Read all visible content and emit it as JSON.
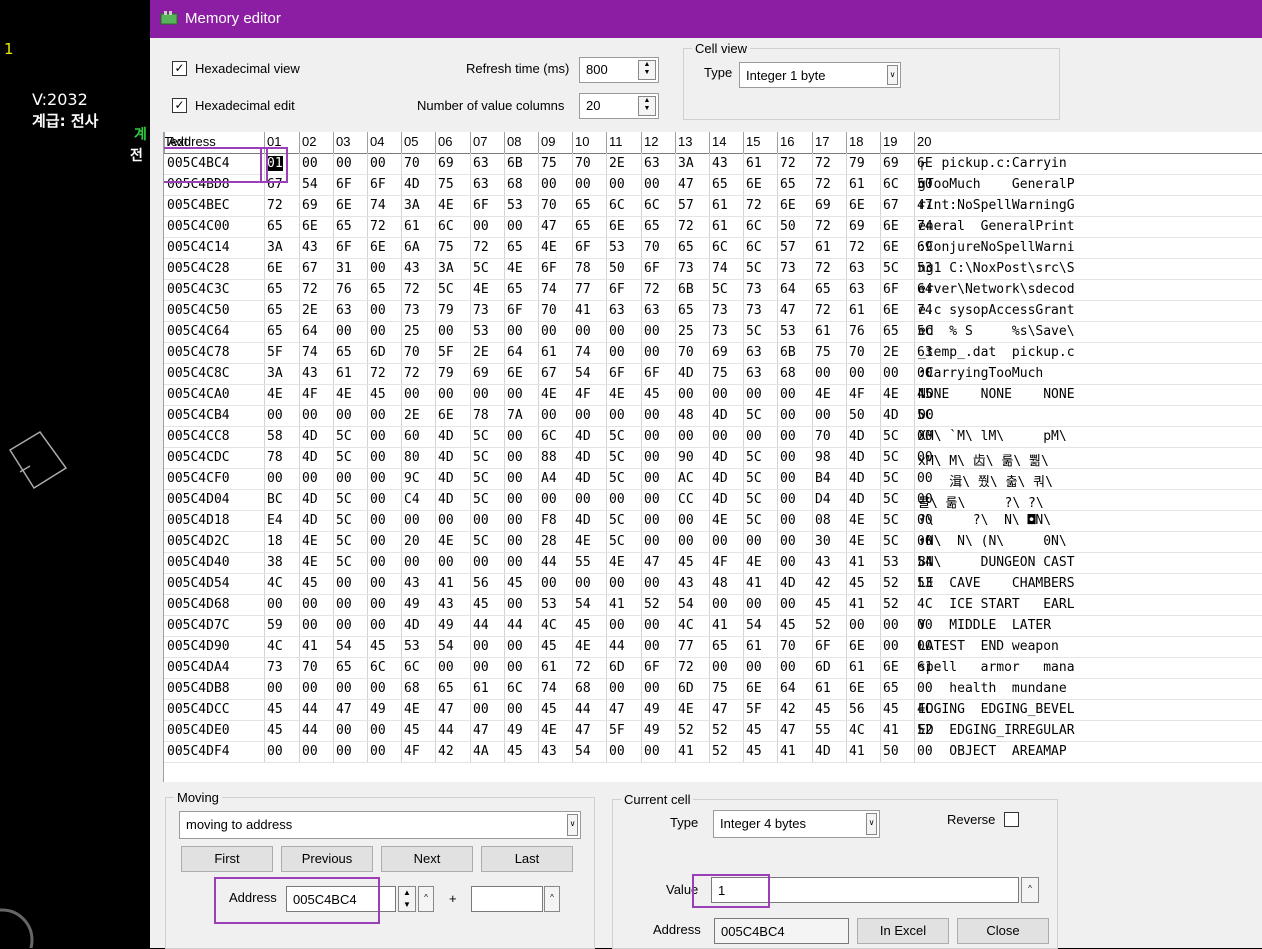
{
  "window": {
    "title": "Memory editor"
  },
  "background": {
    "text1": "1",
    "text2": "V:2032",
    "text3": "계급: 전사",
    "text4": "계",
    "text5": "전"
  },
  "options": {
    "hex_view_label": "Hexadecimal view",
    "hex_view_checked": "✓",
    "hex_edit_label": "Hexadecimal edit",
    "hex_edit_checked": "✓",
    "refresh_label": "Refresh time (ms)",
    "refresh_value": "800",
    "columns_label": "Number of value columns",
    "columns_value": "20"
  },
  "cell_view": {
    "title": "Cell view",
    "type_label": "Type",
    "type_value": "Integer 1 byte"
  },
  "grid": {
    "headers": [
      "Address",
      "01",
      "02",
      "03",
      "04",
      "05",
      "06",
      "07",
      "08",
      "09",
      "10",
      "11",
      "12",
      "13",
      "14",
      "15",
      "16",
      "17",
      "18",
      "19",
      "20",
      "Text"
    ],
    "rows": [
      [
        "005C4BC4",
        "01",
        "00",
        "00",
        "00",
        "70",
        "69",
        "63",
        "6B",
        "75",
        "70",
        "2E",
        "63",
        "3A",
        "43",
        "61",
        "72",
        "72",
        "79",
        "69",
        "6E",
        "┌  pickup.c:Carryin"
      ],
      [
        "005C4BD8",
        "67",
        "54",
        "6F",
        "6F",
        "4D",
        "75",
        "63",
        "68",
        "00",
        "00",
        "00",
        "00",
        "47",
        "65",
        "6E",
        "65",
        "72",
        "61",
        "6C",
        "50",
        "gTooMuch    GeneralP"
      ],
      [
        "005C4BEC",
        "72",
        "69",
        "6E",
        "74",
        "3A",
        "4E",
        "6F",
        "53",
        "70",
        "65",
        "6C",
        "6C",
        "57",
        "61",
        "72",
        "6E",
        "69",
        "6E",
        "67",
        "47",
        "rint:NoSpellWarningG"
      ],
      [
        "005C4C00",
        "65",
        "6E",
        "65",
        "72",
        "61",
        "6C",
        "00",
        "00",
        "47",
        "65",
        "6E",
        "65",
        "72",
        "61",
        "6C",
        "50",
        "72",
        "69",
        "6E",
        "74",
        "eneral  GeneralPrint"
      ],
      [
        "005C4C14",
        "3A",
        "43",
        "6F",
        "6E",
        "6A",
        "75",
        "72",
        "65",
        "4E",
        "6F",
        "53",
        "70",
        "65",
        "6C",
        "6C",
        "57",
        "61",
        "72",
        "6E",
        "69",
        ":ConjureNoSpellWarni"
      ],
      [
        "005C4C28",
        "6E",
        "67",
        "31",
        "00",
        "43",
        "3A",
        "5C",
        "4E",
        "6F",
        "78",
        "50",
        "6F",
        "73",
        "74",
        "5C",
        "73",
        "72",
        "63",
        "5C",
        "53",
        "ng1 C:\\NoxPost\\src\\S"
      ],
      [
        "005C4C3C",
        "65",
        "72",
        "76",
        "65",
        "72",
        "5C",
        "4E",
        "65",
        "74",
        "77",
        "6F",
        "72",
        "6B",
        "5C",
        "73",
        "64",
        "65",
        "63",
        "6F",
        "64",
        "erver\\Network\\sdecod"
      ],
      [
        "005C4C50",
        "65",
        "2E",
        "63",
        "00",
        "73",
        "79",
        "73",
        "6F",
        "70",
        "41",
        "63",
        "63",
        "65",
        "73",
        "73",
        "47",
        "72",
        "61",
        "6E",
        "74",
        "e.c sysopAccessGrant"
      ],
      [
        "005C4C64",
        "65",
        "64",
        "00",
        "00",
        "25",
        "00",
        "53",
        "00",
        "00",
        "00",
        "00",
        "00",
        "25",
        "73",
        "5C",
        "53",
        "61",
        "76",
        "65",
        "5C",
        "ed  % S     %s\\Save\\"
      ],
      [
        "005C4C78",
        "5F",
        "74",
        "65",
        "6D",
        "70",
        "5F",
        "2E",
        "64",
        "61",
        "74",
        "00",
        "00",
        "70",
        "69",
        "63",
        "6B",
        "75",
        "70",
        "2E",
        "63",
        "_temp_.dat  pickup.c"
      ],
      [
        "005C4C8C",
        "3A",
        "43",
        "61",
        "72",
        "72",
        "79",
        "69",
        "6E",
        "67",
        "54",
        "6F",
        "6F",
        "4D",
        "75",
        "63",
        "68",
        "00",
        "00",
        "00",
        "00",
        ":CarryingTooMuch"
      ],
      [
        "005C4CA0",
        "4E",
        "4F",
        "4E",
        "45",
        "00",
        "00",
        "00",
        "00",
        "4E",
        "4F",
        "4E",
        "45",
        "00",
        "00",
        "00",
        "00",
        "4E",
        "4F",
        "4E",
        "45",
        "NONE    NONE    NONE"
      ],
      [
        "005C4CB4",
        "00",
        "00",
        "00",
        "00",
        "2E",
        "6E",
        "78",
        "7A",
        "00",
        "00",
        "00",
        "00",
        "48",
        "4D",
        "5C",
        "00",
        "00",
        "50",
        "4D",
        "5C",
        "00",
        "    .nxz    HM\\ PM\\"
      ],
      [
        "005C4CC8",
        "58",
        "4D",
        "5C",
        "00",
        "60",
        "4D",
        "5C",
        "00",
        "6C",
        "4D",
        "5C",
        "00",
        "00",
        "00",
        "00",
        "00",
        "70",
        "4D",
        "5C",
        "00",
        "XM\\ `M\\ lM\\     pM\\"
      ],
      [
        "005C4CDC",
        "78",
        "4D",
        "5C",
        "00",
        "80",
        "4D",
        "5C",
        "00",
        "88",
        "4D",
        "5C",
        "00",
        "90",
        "4D",
        "5C",
        "00",
        "98",
        "4D",
        "5C",
        "00",
        "xM\\ M\\ ⻮\\ 룲\\ 뿲\\"
      ],
      [
        "005C4CF0",
        "00",
        "00",
        "00",
        "00",
        "9C",
        "4D",
        "5C",
        "00",
        "A4",
        "4D",
        "5C",
        "00",
        "AC",
        "4D",
        "5C",
        "00",
        "B4",
        "4D",
        "5C",
        "00",
        "    湒\\ 쭸\\ 춟\\ 쿼\\"
      ],
      [
        "005C4D04",
        "BC",
        "4D",
        "5C",
        "00",
        "C4",
        "4D",
        "5C",
        "00",
        "00",
        "00",
        "00",
        "00",
        "CC",
        "4D",
        "5C",
        "00",
        "D4",
        "4D",
        "5C",
        "00",
        "쿨\\ 룲\\     ?\\ ?\\"
      ],
      [
        "005C4D18",
        "E4",
        "4D",
        "5C",
        "00",
        "00",
        "00",
        "00",
        "00",
        "F8",
        "4D",
        "5C",
        "00",
        "00",
        "4E",
        "5C",
        "00",
        "08",
        "4E",
        "5C",
        "00",
        "?\\     ?\\  N\\ ◘N\\"
      ],
      [
        "005C4D2C",
        "18",
        "4E",
        "5C",
        "00",
        "20",
        "4E",
        "5C",
        "00",
        "28",
        "4E",
        "5C",
        "00",
        "00",
        "00",
        "00",
        "00",
        "30",
        "4E",
        "5C",
        "00",
        "↑N\\  N\\ (N\\     0N\\"
      ],
      [
        "005C4D40",
        "38",
        "4E",
        "5C",
        "00",
        "00",
        "00",
        "00",
        "00",
        "44",
        "55",
        "4E",
        "47",
        "45",
        "4F",
        "4E",
        "00",
        "43",
        "41",
        "53",
        "54",
        "8N\\     DUNGEON CAST"
      ],
      [
        "005C4D54",
        "4C",
        "45",
        "00",
        "00",
        "43",
        "41",
        "56",
        "45",
        "00",
        "00",
        "00",
        "00",
        "43",
        "48",
        "41",
        "4D",
        "42",
        "45",
        "52",
        "53",
        "LE  CAVE    CHAMBERS"
      ],
      [
        "005C4D68",
        "00",
        "00",
        "00",
        "00",
        "49",
        "43",
        "45",
        "00",
        "53",
        "54",
        "41",
        "52",
        "54",
        "00",
        "00",
        "00",
        "45",
        "41",
        "52",
        "4C",
        "    ICE START   EARL"
      ],
      [
        "005C4D7C",
        "59",
        "00",
        "00",
        "00",
        "4D",
        "49",
        "44",
        "44",
        "4C",
        "45",
        "00",
        "00",
        "4C",
        "41",
        "54",
        "45",
        "52",
        "00",
        "00",
        "00",
        "Y   MIDDLE  LATER"
      ],
      [
        "005C4D90",
        "4C",
        "41",
        "54",
        "45",
        "53",
        "54",
        "00",
        "00",
        "45",
        "4E",
        "44",
        "00",
        "77",
        "65",
        "61",
        "70",
        "6F",
        "6E",
        "00",
        "00",
        "LATEST  END weapon"
      ],
      [
        "005C4DA4",
        "73",
        "70",
        "65",
        "6C",
        "6C",
        "00",
        "00",
        "00",
        "61",
        "72",
        "6D",
        "6F",
        "72",
        "00",
        "00",
        "00",
        "6D",
        "61",
        "6E",
        "61",
        "spell   armor   mana"
      ],
      [
        "005C4DB8",
        "00",
        "00",
        "00",
        "00",
        "68",
        "65",
        "61",
        "6C",
        "74",
        "68",
        "00",
        "00",
        "6D",
        "75",
        "6E",
        "64",
        "61",
        "6E",
        "65",
        "00",
        "    health  mundane"
      ],
      [
        "005C4DCC",
        "45",
        "44",
        "47",
        "49",
        "4E",
        "47",
        "00",
        "00",
        "45",
        "44",
        "47",
        "49",
        "4E",
        "47",
        "5F",
        "42",
        "45",
        "56",
        "45",
        "4C",
        "EDGING  EDGING_BEVEL"
      ],
      [
        "005C4DE0",
        "45",
        "44",
        "00",
        "00",
        "45",
        "44",
        "47",
        "49",
        "4E",
        "47",
        "5F",
        "49",
        "52",
        "52",
        "45",
        "47",
        "55",
        "4C",
        "41",
        "52",
        "ED  EDGING_IRREGULAR"
      ],
      [
        "005C4DF4",
        "00",
        "00",
        "00",
        "00",
        "4F",
        "42",
        "4A",
        "45",
        "43",
        "54",
        "00",
        "00",
        "41",
        "52",
        "45",
        "41",
        "4D",
        "41",
        "50",
        "00",
        "    OBJECT  AREAMAP"
      ]
    ]
  },
  "moving": {
    "title": "Moving",
    "mode_value": "moving to address",
    "first": "First",
    "previous": "Previous",
    "next": "Next",
    "last": "Last",
    "address_label": "Address",
    "address_value": "005C4BC4",
    "plus": "+",
    "offset_value": ""
  },
  "current_cell": {
    "title": "Current cell",
    "type_label": "Type",
    "type_value": "Integer 4 bytes",
    "reverse_label": "Reverse",
    "value_label": "Value",
    "value": "1",
    "address_label": "Address",
    "address_value": "005C4BC4",
    "in_excel": "In Excel",
    "close": "Close"
  },
  "colors": {
    "titlebar": "#8c1ea3",
    "highlight": "#9a3fb8",
    "accent_green": "#2ecc40"
  }
}
